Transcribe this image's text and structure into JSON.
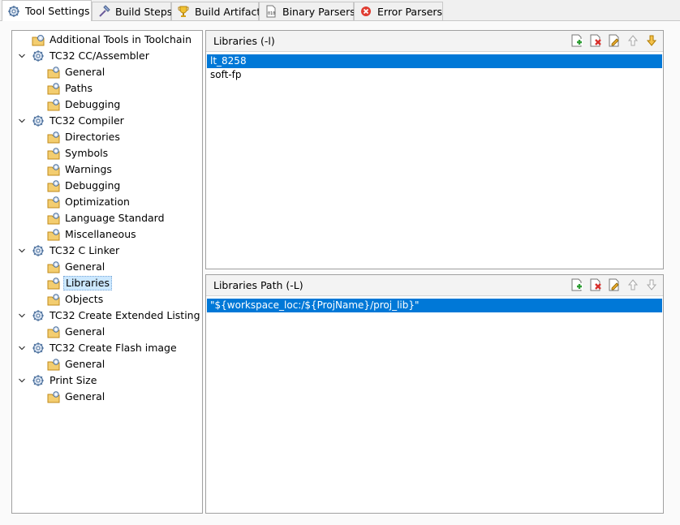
{
  "tabs": [
    {
      "label": "Tool Settings",
      "icon": "gear-icon",
      "active": true
    },
    {
      "label": "Build Steps",
      "icon": "hammer-icon",
      "active": false
    },
    {
      "label": "Build Artifact",
      "icon": "trophy-icon",
      "active": false
    },
    {
      "label": "Binary Parsers",
      "icon": "binary-file-icon",
      "active": false
    },
    {
      "label": "Error Parsers",
      "icon": "error-icon",
      "active": false
    }
  ],
  "tree": [
    {
      "label": "Additional Tools in Toolchain",
      "level": 0,
      "expandable": false,
      "icon": "tool-icon"
    },
    {
      "label": "TC32 CC/Assembler",
      "level": 0,
      "expandable": true,
      "icon": "gear-icon"
    },
    {
      "label": "General",
      "level": 1,
      "icon": "settings-folder-icon"
    },
    {
      "label": "Paths",
      "level": 1,
      "icon": "settings-folder-icon"
    },
    {
      "label": "Debugging",
      "level": 1,
      "icon": "settings-folder-icon"
    },
    {
      "label": "TC32 Compiler",
      "level": 0,
      "expandable": true,
      "icon": "gear-icon"
    },
    {
      "label": "Directories",
      "level": 1,
      "icon": "settings-folder-icon"
    },
    {
      "label": "Symbols",
      "level": 1,
      "icon": "settings-folder-icon"
    },
    {
      "label": "Warnings",
      "level": 1,
      "icon": "settings-folder-icon"
    },
    {
      "label": "Debugging",
      "level": 1,
      "icon": "settings-folder-icon"
    },
    {
      "label": "Optimization",
      "level": 1,
      "icon": "settings-folder-icon"
    },
    {
      "label": "Language Standard",
      "level": 1,
      "icon": "settings-folder-icon"
    },
    {
      "label": "Miscellaneous",
      "level": 1,
      "icon": "settings-folder-icon"
    },
    {
      "label": "TC32 C Linker",
      "level": 0,
      "expandable": true,
      "icon": "gear-icon"
    },
    {
      "label": "General",
      "level": 1,
      "icon": "settings-folder-icon"
    },
    {
      "label": "Libraries",
      "level": 1,
      "icon": "settings-folder-icon",
      "selected": true
    },
    {
      "label": "Objects",
      "level": 1,
      "icon": "settings-folder-icon"
    },
    {
      "label": "TC32 Create Extended Listing",
      "level": 0,
      "expandable": true,
      "icon": "gear-icon"
    },
    {
      "label": "General",
      "level": 1,
      "icon": "settings-folder-icon"
    },
    {
      "label": "TC32 Create Flash image",
      "level": 0,
      "expandable": true,
      "icon": "gear-icon"
    },
    {
      "label": "General",
      "level": 1,
      "icon": "settings-folder-icon"
    },
    {
      "label": "Print Size",
      "level": 0,
      "expandable": true,
      "icon": "gear-icon"
    },
    {
      "label": "General",
      "level": 1,
      "icon": "settings-folder-icon"
    }
  ],
  "libraries": {
    "title": "Libraries (-l)",
    "items": [
      {
        "value": "lt_8258",
        "selected": true
      },
      {
        "value": "soft-fp",
        "selected": false
      }
    ],
    "toolbar": [
      "add-icon",
      "delete-icon",
      "edit-icon",
      "move-up-icon",
      "move-down-icon"
    ]
  },
  "library_paths": {
    "title": "Libraries Path (-L)",
    "items": [
      {
        "value": "\"${workspace_loc:/${ProjName}/proj_lib}\"",
        "selected": true
      }
    ],
    "toolbar": [
      "add-icon",
      "delete-icon",
      "edit-icon",
      "move-up-icon",
      "move-down-icon"
    ]
  },
  "colors": {
    "selection": "#0078d7",
    "tree_selection": "#cce8ff",
    "folder": "#e8b85a",
    "gear": "#4a7ab5"
  }
}
